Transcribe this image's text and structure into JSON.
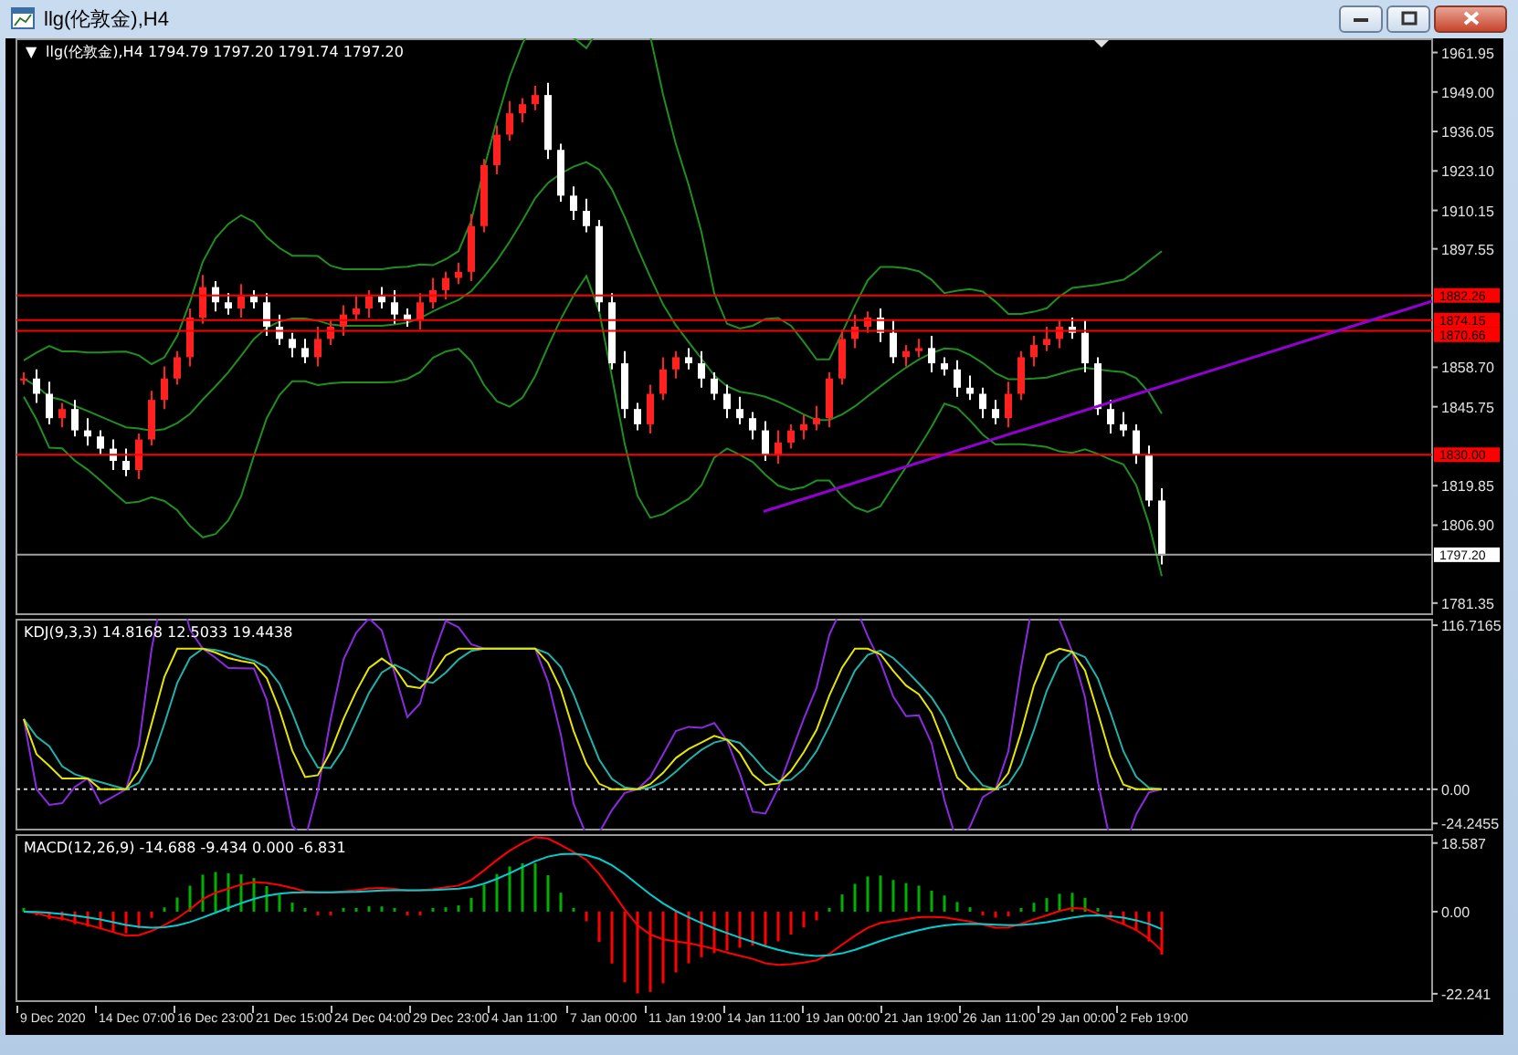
{
  "window": {
    "title": "llg(伦敦金),H4"
  },
  "price_panel": {
    "marker": "▼",
    "header": "llg(伦敦金),H4  1794.79 1797.20 1791.74 1797.20",
    "axis_labels": [
      "1961.95",
      "1949.00",
      "1936.05",
      "1923.10",
      "1910.15",
      "1897.55",
      "1858.70",
      "1845.75",
      "1819.85",
      "1806.90",
      "1781.35"
    ],
    "level_tags": [
      {
        "label": "1882.26",
        "color": "#ff0000"
      },
      {
        "label": "1874.15",
        "color": "#ff0000"
      },
      {
        "label": "1870.66",
        "color": "#ff0000"
      },
      {
        "label": "1830.00",
        "color": "#ff0000"
      },
      {
        "label": "1797.20",
        "color": "#ffffff"
      }
    ]
  },
  "kdj_panel": {
    "header": "KDJ(9,3,3) 14.8168 12.5033 19.4438",
    "axis_labels": [
      "116.7165",
      "0.00",
      "-24.2455"
    ]
  },
  "macd_panel": {
    "header": "MACD(12,26,9) -14.688 -9.434 0.000 -6.831",
    "axis_labels": [
      "18.587",
      "0.00",
      "-22.241"
    ]
  },
  "time_axis": [
    "9 Dec 2020",
    "14 Dec 07:00",
    "16 Dec 23:00",
    "21 Dec 15:00",
    "24 Dec 04:00",
    "29 Dec 23:00",
    "4 Jan 11:00",
    "7 Jan 00:00",
    "11 Jan 19:00",
    "14 Jan 11:00",
    "19 Jan 00:00",
    "21 Jan 19:00",
    "26 Jan 11:00",
    "29 Jan 00:00",
    "2 Feb 19:00"
  ]
}
